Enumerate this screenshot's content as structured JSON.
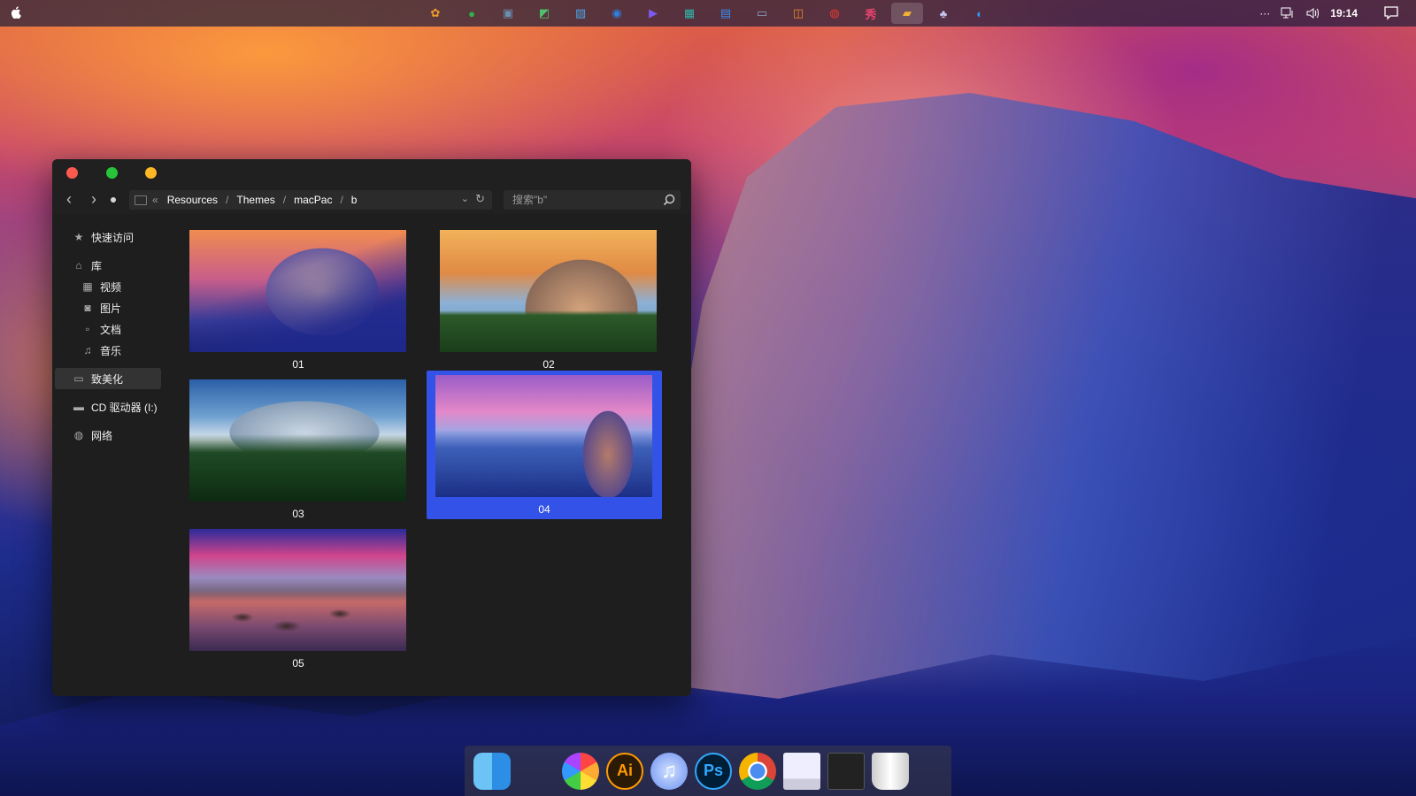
{
  "menubar": {
    "tray_apps": [
      {
        "icon": "paw-icon",
        "color": "#f29d2b",
        "glyph": "✿"
      },
      {
        "icon": "wechat-icon",
        "color": "#2db34a",
        "glyph": "●"
      },
      {
        "icon": "image-frame-icon",
        "color": "#6b8fb3",
        "glyph": "▣"
      },
      {
        "icon": "chart-green-icon",
        "color": "#4fc36b",
        "glyph": "◩"
      },
      {
        "icon": "photo-viewer-icon",
        "color": "#4aa7e6",
        "glyph": "▨"
      },
      {
        "icon": "globe-blue-icon",
        "color": "#2f7fe0",
        "glyph": "◉"
      },
      {
        "icon": "play-icon",
        "color": "#7a5af0",
        "glyph": "▶"
      },
      {
        "icon": "screen-capture-icon",
        "color": "#2fb5a8",
        "glyph": "▦"
      },
      {
        "icon": "clipboard-icon",
        "color": "#3a8df0",
        "glyph": "▤"
      },
      {
        "icon": "terminal-icon",
        "color": "#8aa0c0",
        "glyph": "▭"
      },
      {
        "icon": "layers-icon",
        "color": "#f08a2a",
        "glyph": "◫"
      },
      {
        "icon": "netease-music-icon",
        "color": "#e53a30",
        "glyph": "◍"
      },
      {
        "icon": "meitu-icon",
        "color": "#e8446e",
        "glyph": "秀"
      },
      {
        "icon": "folder-icon",
        "color": "#f2b233",
        "glyph": "▰"
      },
      {
        "icon": "qq-icon",
        "color": "#c6c6f0",
        "glyph": "♣"
      },
      {
        "icon": "browser-icon",
        "color": "#2d9cf0",
        "glyph": "◐"
      }
    ],
    "more": "···",
    "clock": "19:14"
  },
  "window": {
    "breadcrumb_lead": "«",
    "breadcrumbs": [
      "Resources",
      "Themes",
      "macPac",
      "b"
    ],
    "search_placeholder": "搜索\"b\"",
    "sidebar": {
      "quick_access": "快速访问",
      "library": "库",
      "library_items": [
        "视频",
        "图片",
        "文档",
        "音乐"
      ],
      "customize": "致美化",
      "cd_drive": "CD 驱动器 (I:)",
      "network": "网络"
    },
    "files": [
      "01",
      "02",
      "03",
      "04",
      "05"
    ],
    "selected_file": "04"
  },
  "dock": {
    "apps": [
      {
        "icon": "finder-icon",
        "label": ""
      },
      {
        "icon": "sketch-icon",
        "label": ""
      },
      {
        "icon": "photos-icon",
        "label": ""
      },
      {
        "icon": "illustrator-icon",
        "label": "Ai"
      },
      {
        "icon": "itunes-icon",
        "label": "♫"
      },
      {
        "icon": "photoshop-icon",
        "label": "Ps"
      },
      {
        "icon": "chrome-icon",
        "label": ""
      },
      {
        "icon": "preview-icon",
        "label": ""
      },
      {
        "icon": "terminal-app-icon",
        "label": ""
      },
      {
        "icon": "trash-icon",
        "label": ""
      }
    ]
  }
}
